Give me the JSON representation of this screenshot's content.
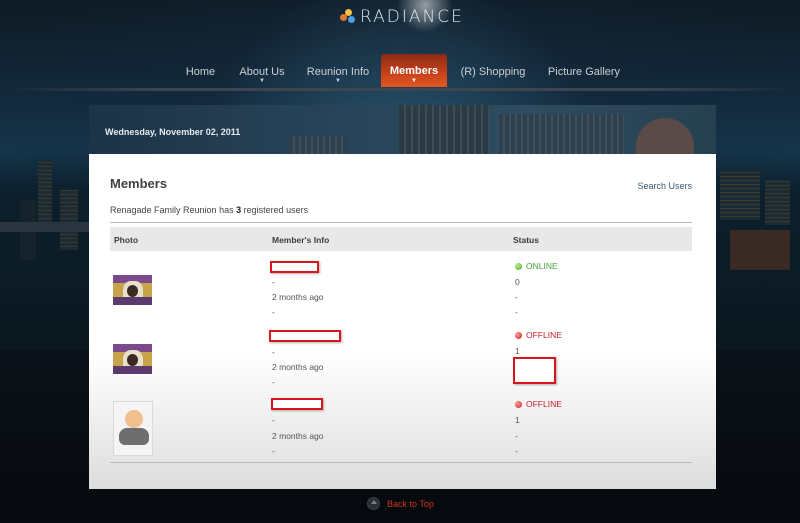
{
  "brand": {
    "name": "RADIANCE"
  },
  "nav": {
    "items": [
      {
        "label": "Home",
        "active": false,
        "dropdown": false
      },
      {
        "label": "About Us",
        "active": false,
        "dropdown": true
      },
      {
        "label": "Reunion Info",
        "active": false,
        "dropdown": true
      },
      {
        "label": "Members",
        "active": true,
        "dropdown": true
      },
      {
        "label": "(R) Shopping",
        "active": false,
        "dropdown": false
      },
      {
        "label": "Picture Gallery",
        "active": false,
        "dropdown": false
      }
    ]
  },
  "header": {
    "date": "Wednesday, November 02, 2011"
  },
  "main": {
    "title": "Members",
    "search_link": "Search Users",
    "summary_prefix": "Renagade Family Reunion has",
    "summary_count": "3",
    "summary_suffix": "registered users",
    "columns": [
      "Photo",
      "Member's Info",
      "Status"
    ],
    "members": [
      {
        "photo": "group-photo",
        "info_lines": [
          "-",
          "2 months ago",
          "-"
        ],
        "status": "ONLINE",
        "status_lines": [
          "0",
          "-",
          "-"
        ]
      },
      {
        "photo": "group-photo",
        "info_lines": [
          "-",
          "2 months ago",
          "-"
        ],
        "status": "OFFLINE",
        "status_lines": [
          "1"
        ]
      },
      {
        "photo": "default-avatar",
        "info_lines": [
          "-",
          "2 months ago",
          "-"
        ],
        "status": "OFFLINE",
        "status_lines": [
          "1",
          "-",
          "-"
        ]
      }
    ]
  },
  "footer": {
    "back_to_top": "Back to Top"
  },
  "colors": {
    "accent": "#d0341a",
    "online": "#46a33a",
    "offline": "#c8222a",
    "link": "#3b5a78"
  }
}
